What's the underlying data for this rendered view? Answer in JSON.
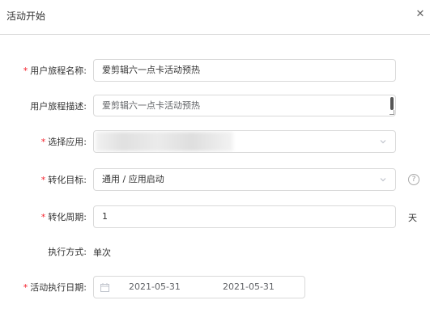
{
  "dialog": {
    "title": "活动开始",
    "close_glyph": "✕"
  },
  "form": {
    "journey_name": {
      "label": "用户旅程名称:",
      "required": "*",
      "value": "爱剪辑六一点卡活动预热"
    },
    "journey_desc": {
      "label": "用户旅程描述:",
      "value": "爱剪辑六一点卡活动预热"
    },
    "app_select": {
      "label": "选择应用:",
      "required": "*",
      "value": ""
    },
    "conversion_goal": {
      "label": "转化目标:",
      "required": "*",
      "value": "通用 / 应用启动",
      "help_glyph": "?"
    },
    "conversion_period": {
      "label": "转化周期:",
      "required": "*",
      "value": "1",
      "unit": "天"
    },
    "execution_mode": {
      "label": "执行方式:",
      "value": "单次"
    },
    "execution_date": {
      "label": "活动执行日期:",
      "required": "*",
      "start": "2021-05-31",
      "end": "2021-05-31"
    }
  },
  "icons": {
    "close": "close-icon",
    "arrow": "chevron-down-icon",
    "help": "help-icon",
    "calendar": "calendar-icon"
  },
  "colors": {
    "required": "#f5222d",
    "border": "#d9d9d9",
    "text": "#333333"
  }
}
